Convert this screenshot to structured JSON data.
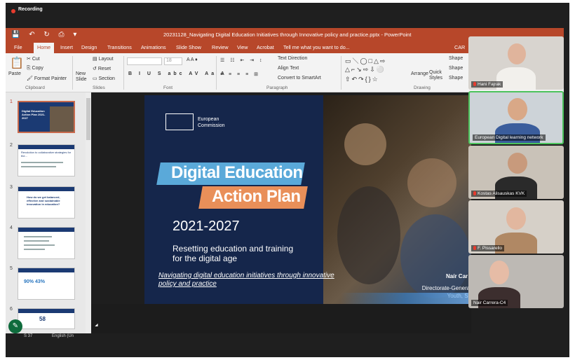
{
  "recording": {
    "label": "Recording"
  },
  "window": {
    "quick_access": "💾 ↶ ↻ ⎙ ▾",
    "doc_title": "20231128_Navigating Digital Education Initiatives through Innovative policy and practice.pptx - PowerPoint"
  },
  "tabs": [
    "File",
    "Home",
    "Insert",
    "Design",
    "Transitions",
    "Animations",
    "Slide Show",
    "Review",
    "View",
    "Acrobat",
    "Tell me what you want to do..."
  ],
  "tab_partial": "CAR",
  "ribbon": {
    "paste": "Paste",
    "cut": "Cut",
    "copy": "Copy",
    "format_painter": "Format Painter",
    "new_slide": "New Slide",
    "layout": "Layout",
    "reset": "Reset",
    "section": "Section",
    "font_size": "18",
    "text_direction": "Text Direction",
    "align_text": "Align Text",
    "convert_smartart": "Convert to SmartArt",
    "arrange": "Arrange",
    "quick_styles": "Quick Styles",
    "shape1": "Shape",
    "shape2": "Shape",
    "shape3": "Shape",
    "groups": {
      "clipboard": "Clipboard",
      "slides": "Slides",
      "font": "Font",
      "paragraph": "Paragraph",
      "drawing": "Drawing"
    }
  },
  "thumbnails": [
    {
      "num": "1",
      "text": "Digital Education Action Plan 2021-2027"
    },
    {
      "num": "2",
      "text": "Revolution to collaborative strategies for the..."
    },
    {
      "num": "3",
      "text": "How do we get balanced, effective and sustainable innovation in education?"
    },
    {
      "num": "4",
      "text": ""
    },
    {
      "num": "5",
      "text": "90% 43%"
    },
    {
      "num": "6",
      "text": "58"
    }
  ],
  "slide": {
    "org_line1": "European",
    "org_line2": "Commission",
    "title_line1": "Digital Education",
    "title_line2": "Action Plan",
    "years": "2021-2027",
    "subtitle": "Resetting education and training for the digital age",
    "navigating": "Navigating digital education initiatives through innovative policy and practice",
    "presenter": "Naír Car",
    "dg": "Directorate-General Youth, Sp"
  },
  "status": {
    "slide_info": "S 37",
    "language": "English (Un"
  },
  "participants": [
    {
      "name": "Hani Fajrak",
      "muted": true
    },
    {
      "name": "European Digital learning network",
      "muted": false
    },
    {
      "name": "Kostas Alisauskas KVK",
      "muted": true
    },
    {
      "name": "F. Pissarello",
      "muted": true
    },
    {
      "name": "Nair Carrera-C4",
      "muted": false
    }
  ],
  "colors": {
    "ppt_accent": "#b7472a",
    "active_speaker": "#4cc35c",
    "slide_bg": "#15264b",
    "band_blue": "#5aa9d9",
    "band_orange": "#e98f59"
  }
}
